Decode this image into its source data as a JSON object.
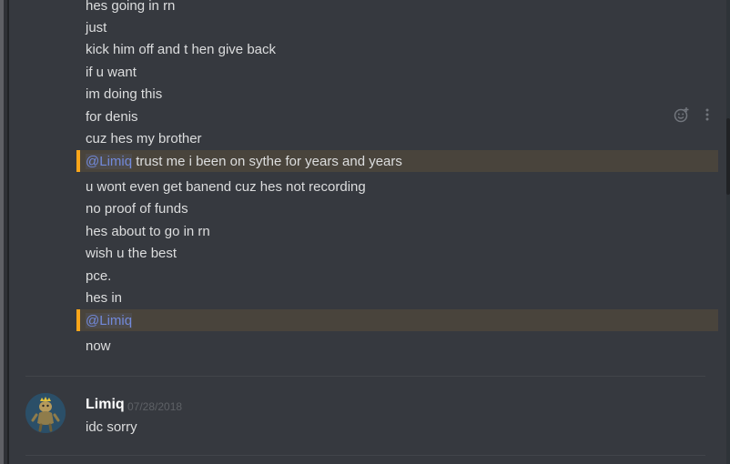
{
  "messages_top": [
    "hes going in rn",
    "just",
    "kick him off and t hen give back",
    "if u want",
    "im doing this",
    "for denis",
    "cuz hes my brother"
  ],
  "mention_1": {
    "tag": "@Limiq",
    "text": " trust me i been on sythe for years and years"
  },
  "messages_mid": [
    "u wont even get banend cuz hes not recording",
    "no proof of funds",
    "hes about to go in rn",
    "wish u the best",
    "pce.",
    "hes in"
  ],
  "mention_2": {
    "tag": "@Limiq",
    "text": ""
  },
  "message_after_mention": "now",
  "message_group_2": {
    "username": "Limiq",
    "timestamp": "07/28/2018",
    "text": "idc sorry"
  },
  "hover_actions": {
    "icons": [
      "add-reaction-icon",
      "more-options-icon"
    ]
  },
  "colors": {
    "background": "#36393f",
    "text": "#dcddde",
    "mention_highlight": "#49443c",
    "mention_border": "#faa61a",
    "mention_text": "#7289da",
    "timestamp": "#5e6166"
  }
}
